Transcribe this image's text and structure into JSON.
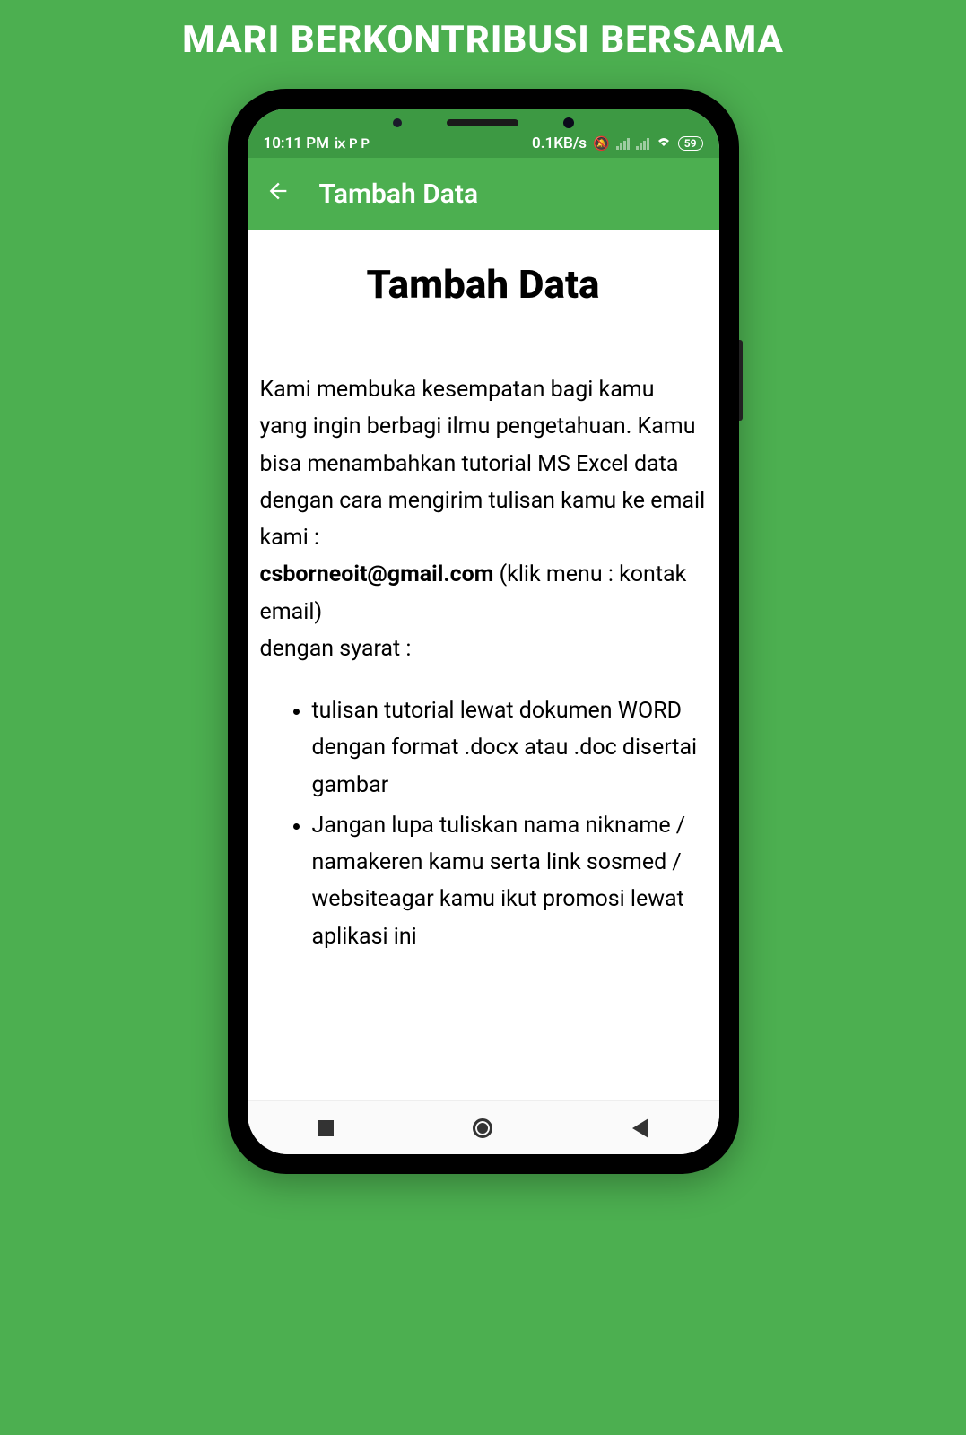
{
  "banner": {
    "text": "MARI BERKONTRIBUSI BERSAMA"
  },
  "status_bar": {
    "time": "10:11 PM",
    "left_icons": "ⅸ P P",
    "speed": "0.1KB/s",
    "battery": "59"
  },
  "app_bar": {
    "title": "Tambah Data"
  },
  "page": {
    "title": "Tambah Data",
    "intro_before_email": "Kami membuka kesempatan bagi kamu yang ingin berbagi ilmu pengetahuan. Kamu bisa menambahkan tutorial MS Excel data dengan cara mengirim tulisan kamu ke email kami :",
    "email": "csborneoit@gmail.com",
    "after_email": " (klik menu : kontak email)",
    "condition_line": "dengan syarat :",
    "bullets": [
      "tulisan tutorial lewat dokumen WORD dengan format .docx atau .doc disertai gambar",
      "Jangan lupa tuliskan nama nikname / namakeren kamu serta link sosmed / websiteagar kamu ikut promosi lewat aplikasi ini"
    ]
  }
}
